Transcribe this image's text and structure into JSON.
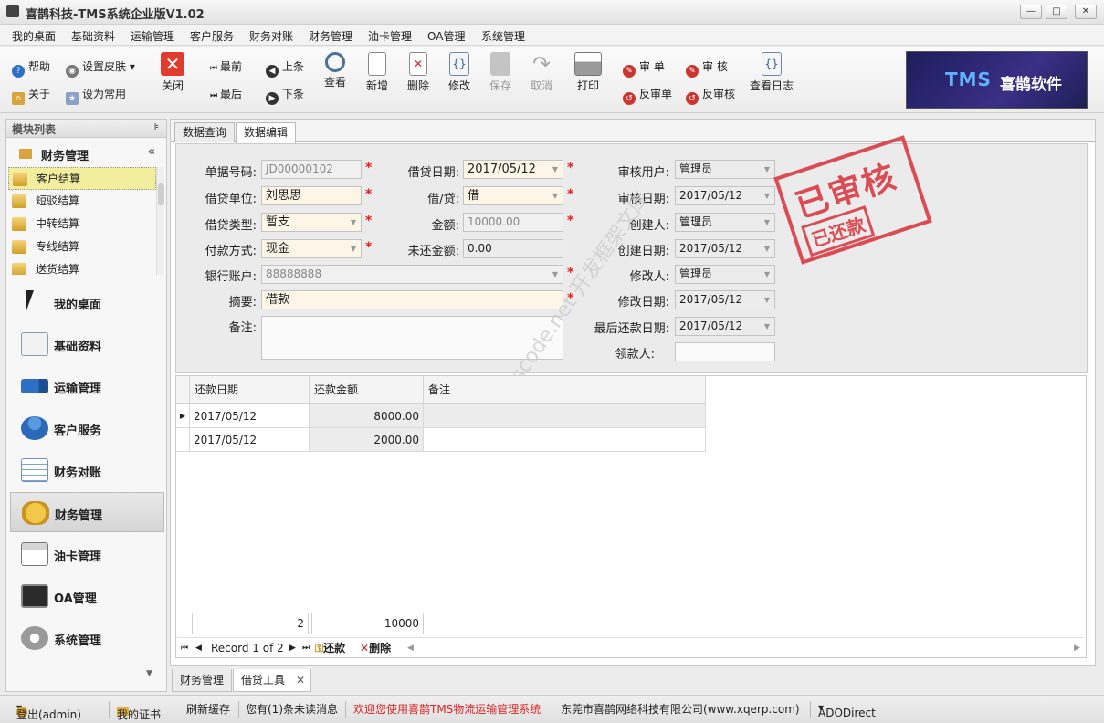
{
  "window": {
    "title": "喜鹊科技-TMS系统企业版V1.02",
    "btn_min": "—",
    "btn_max": "□",
    "btn_close": "✕"
  },
  "menu": [
    "我的桌面",
    "基础资料",
    "运输管理",
    "客户服务",
    "财务对账",
    "财务管理",
    "油卡管理",
    "OA管理",
    "系统管理"
  ],
  "toolbar": {
    "help": "帮助",
    "skin": "设置皮肤",
    "about": "关于",
    "favorite": "设为常用",
    "close": "关闭",
    "first": "最前",
    "last": "最后",
    "prev": "上条",
    "next": "下条",
    "view": "查看",
    "add": "新增",
    "delete": "删除",
    "edit": "修改",
    "save": "保存",
    "cancel": "取消",
    "print": "打印",
    "audit": "审 单",
    "audit2": "审 核",
    "unaudit": "反审单",
    "unaudit2": "反审核",
    "log": "查看日志"
  },
  "banner": {
    "text1": "TMS",
    "text2": "喜鹊软件"
  },
  "left": {
    "header": "模块列表",
    "group": "财务管理",
    "items": [
      "客户结算",
      "短驳结算",
      "中转结算",
      "专线结算",
      "送货结算"
    ],
    "nav": [
      "我的桌面",
      "基础资料",
      "运输管理",
      "客户服务",
      "财务对账",
      "财务管理",
      "油卡管理",
      "OA管理",
      "系统管理"
    ]
  },
  "tabs": [
    "数据查询",
    "数据编辑"
  ],
  "form": {
    "doc_no_label": "单据号码:",
    "doc_no": "JD00000102",
    "loan_date_label": "借贷日期:",
    "loan_date": "2017/05/12",
    "audit_user_label": "审核用户:",
    "audit_user": "管理员",
    "unit_label": "借贷单位:",
    "unit": "刘思思",
    "dc_label": "借/贷:",
    "dc": "借",
    "audit_date_label": "审核日期:",
    "audit_date": "2017/05/12",
    "type_label": "借贷类型:",
    "type": "暂支",
    "amount_label": "金额:",
    "amount": "10000.00",
    "creator_label": "创建人:",
    "creator": "管理员",
    "pay_label": "付款方式:",
    "pay": "现金",
    "unpaid_label": "未还金额:",
    "unpaid": "0.00",
    "create_date_label": "创建日期:",
    "create_date": "2017/05/12",
    "bank_label": "银行账户:",
    "bank": "88888888",
    "modifier_label": "修改人:",
    "modifier": "管理员",
    "summary_label": "摘要:",
    "summary": "借款",
    "modify_date_label": "修改日期:",
    "modify_date": "2017/05/12",
    "remark_label": "备注:",
    "remark": "",
    "last_repay_label": "最后还款日期:",
    "last_repay": "2017/05/12",
    "receiver_label": "领款人:",
    "receiver": ""
  },
  "stamp": {
    "main": "已审核",
    "sub": "已还款"
  },
  "watermark": "www.cscode.net 开发框架文库",
  "grid": {
    "headers": [
      "还款日期",
      "还款金额",
      "备注"
    ],
    "rows": [
      [
        "2017/05/12",
        "8000.00",
        ""
      ],
      [
        "2017/05/12",
        "2000.00",
        ""
      ]
    ],
    "sum_count": "2",
    "sum_amount": "10000",
    "record": "Record 1 of 2",
    "repay": "还款",
    "del": "删除"
  },
  "bottom_tabs": [
    "财务管理",
    "借贷工具"
  ],
  "status": {
    "login": "登出(admin)",
    "cert": "我的证书",
    "refresh": "刷新缓存",
    "msg": "您有(1)条未读消息",
    "welcome": "欢迎您使用喜鹊TMS物流运输管理系统",
    "company": "东莞市喜鹊网络科技有限公司(www.xqerp.com)",
    "conn": "ADODirect"
  },
  "colors": {
    "accent_red": "#d8303a",
    "required": "#e02020",
    "field_bg": "#fdf5e6"
  }
}
